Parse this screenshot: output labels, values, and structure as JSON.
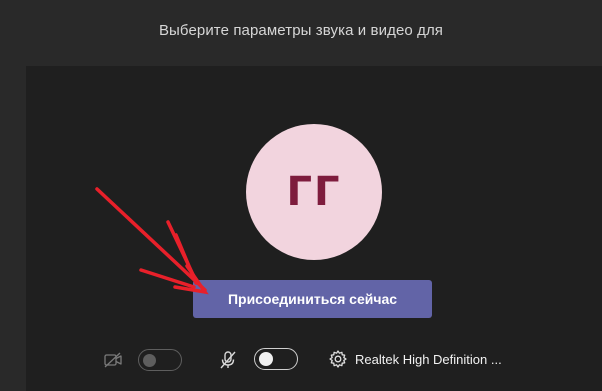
{
  "dialog": {
    "title": "Выберите параметры звука и видео для"
  },
  "avatar": {
    "initials": "ГГ",
    "background": "#f2d4de",
    "text_color": "#7e1c3d"
  },
  "join_button": {
    "label": "Присоединиться сейчас",
    "color": "#6264a7"
  },
  "controls": {
    "camera": {
      "icon": "camera-off-icon",
      "toggle_state": "off"
    },
    "microphone": {
      "icon": "mic-off-icon",
      "toggle_state": "off"
    },
    "device_settings": {
      "icon": "gear-icon",
      "label": "Realtek High Definition ..."
    }
  },
  "annotation": {
    "icon": "red-arrow-icon",
    "color": "#e8202a"
  }
}
